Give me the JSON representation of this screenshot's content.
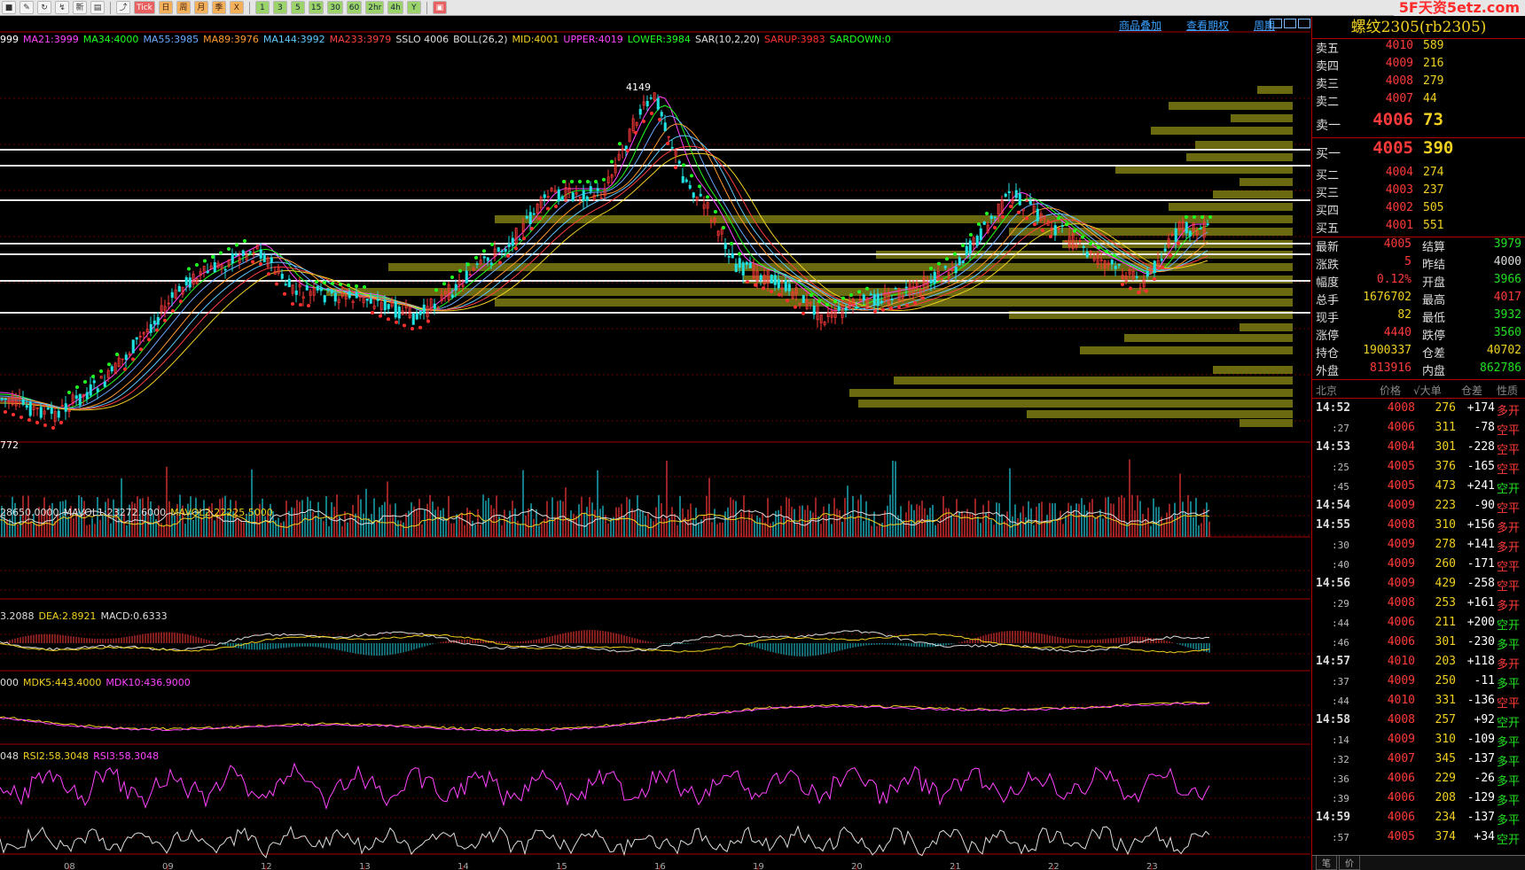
{
  "toolbar": {
    "buttons": [
      "■",
      "✎",
      "↻",
      "↯",
      "新",
      "▤",
      "⤴",
      "Tick",
      "日",
      "周",
      "月",
      "季",
      "X",
      "1",
      "3",
      "5",
      "15",
      "30",
      "60",
      "2hr",
      "4h",
      "Y",
      "▣"
    ],
    "watermark": "5F天资5etz.com"
  },
  "chart": {
    "links": [
      "商品叠加",
      "查看期权",
      "周期"
    ],
    "ma_legend": [
      {
        "text": "999",
        "color": "#ffffff"
      },
      {
        "text": "MA21:3999",
        "color": "#ff44ff"
      },
      {
        "text": "MA34:4000",
        "color": "#20ff20"
      },
      {
        "text": "MA55:3985",
        "color": "#6aa8ff"
      },
      {
        "text": "MA89:3976",
        "color": "#ff9a30"
      },
      {
        "text": "MA144:3992",
        "color": "#60c8ff"
      },
      {
        "text": "MA233:3979",
        "color": "#ff4040"
      },
      {
        "text": "SSLO 4006",
        "color": "#dddddd"
      },
      {
        "text": "BOLL(26,2)",
        "color": "#dddddd"
      },
      {
        "text": "MID:4001",
        "color": "#f0d020"
      },
      {
        "text": "UPPER:4019",
        "color": "#ff44ff"
      },
      {
        "text": "LOWER:3984",
        "color": "#20ff20"
      },
      {
        "text": "SAR(10,2,20)",
        "color": "#dddddd"
      },
      {
        "text": "SARUP:3983",
        "color": "#ff3030"
      },
      {
        "text": "SARDOWN:0",
        "color": "#20ff20"
      }
    ],
    "high_label": "4149",
    "low_label": "772",
    "vol_legend": [
      {
        "text": "28650.0000",
        "color": "#dddddd"
      },
      {
        "text": "MAVOL1:23272.6000",
        "color": "#dddddd"
      },
      {
        "text": "MAVOL2:22225.5000",
        "color": "#f0d020"
      }
    ],
    "macd_legend": [
      {
        "text": "3.2088",
        "color": "#dddddd"
      },
      {
        "text": "DEA:2.8921",
        "color": "#f0d020"
      },
      {
        "text": "MACD:0.6333",
        "color": "#dddddd"
      }
    ],
    "mdk_legend": [
      {
        "text": "000",
        "color": "#dddddd"
      },
      {
        "text": "MDK5:443.4000",
        "color": "#f0d020"
      },
      {
        "text": "MDK10:436.9000",
        "color": "#ff44ff"
      }
    ],
    "rsi_legend": [
      {
        "text": "048",
        "color": "#dddddd"
      },
      {
        "text": "RSI2:58.3048",
        "color": "#f0d020"
      },
      {
        "text": "RSI3:58.3048",
        "color": "#ff44ff"
      }
    ],
    "date_ticks": [
      "08",
      "09",
      "12",
      "13",
      "14",
      "15",
      "16",
      "19",
      "20",
      "21",
      "22",
      "23"
    ]
  },
  "quote": {
    "title": "螺纹2305(rb2305)",
    "asks": [
      {
        "label": "卖五",
        "price": "4010",
        "vol": "589"
      },
      {
        "label": "卖四",
        "price": "4009",
        "vol": "216"
      },
      {
        "label": "卖三",
        "price": "4008",
        "vol": "279"
      },
      {
        "label": "卖二",
        "price": "4007",
        "vol": "44"
      },
      {
        "label": "卖一",
        "price": "4006",
        "vol": "73"
      }
    ],
    "bids": [
      {
        "label": "买一",
        "price": "4005",
        "vol": "390"
      },
      {
        "label": "买二",
        "price": "4004",
        "vol": "274"
      },
      {
        "label": "买三",
        "price": "4003",
        "vol": "237"
      },
      {
        "label": "买四",
        "price": "4002",
        "vol": "505"
      },
      {
        "label": "买五",
        "price": "4001",
        "vol": "551"
      }
    ],
    "stats": [
      {
        "l1": "最新",
        "v1": "4005",
        "c1": "red",
        "l2": "结算",
        "v2": "3979",
        "c2": "green"
      },
      {
        "l1": "涨跌",
        "v1": "5",
        "c1": "red",
        "l2": "昨结",
        "v2": "4000",
        "c2": "white"
      },
      {
        "l1": "幅度",
        "v1": "0.12%",
        "c1": "red",
        "l2": "开盘",
        "v2": "3966",
        "c2": "green"
      },
      {
        "l1": "总手",
        "v1": "1676702",
        "c1": "yellow",
        "l2": "最高",
        "v2": "4017",
        "c2": "red"
      },
      {
        "l1": "现手",
        "v1": "82",
        "c1": "yellow",
        "l2": "最低",
        "v2": "3932",
        "c2": "green"
      },
      {
        "l1": "涨停",
        "v1": "4440",
        "c1": "red",
        "l2": "跌停",
        "v2": "3560",
        "c2": "green"
      },
      {
        "l1": "持仓",
        "v1": "1900337",
        "c1": "yellow",
        "l2": "仓差",
        "v2": "40702",
        "c2": "yellow"
      },
      {
        "l1": "外盘",
        "v1": "813916",
        "c1": "red",
        "l2": "内盘",
        "v2": "862786",
        "c2": "green"
      }
    ],
    "tick_header": [
      "北京",
      "价格",
      "√大单",
      "仓差",
      "性质"
    ],
    "ticks": [
      {
        "time": "14:52",
        "sub": false,
        "price": "4008",
        "pc": "red",
        "vol": "276",
        "oi": "+174",
        "oc": "white",
        "nature": "多开",
        "nc": "red"
      },
      {
        "time": ":27",
        "sub": true,
        "price": "4006",
        "pc": "red",
        "vol": "311",
        "oi": "-78",
        "oc": "white",
        "nature": "空平",
        "nc": "red"
      },
      {
        "time": "14:53",
        "sub": false,
        "price": "4004",
        "pc": "red",
        "vol": "301",
        "oi": "-228",
        "oc": "white",
        "nature": "空平",
        "nc": "red"
      },
      {
        "time": ":25",
        "sub": true,
        "price": "4005",
        "pc": "red",
        "vol": "376",
        "oi": "-165",
        "oc": "white",
        "nature": "空平",
        "nc": "red"
      },
      {
        "time": ":45",
        "sub": true,
        "price": "4005",
        "pc": "red",
        "vol": "473",
        "oi": "+241",
        "oc": "white",
        "nature": "空开",
        "nc": "green"
      },
      {
        "time": "14:54",
        "sub": false,
        "price": "4009",
        "pc": "red",
        "vol": "223",
        "oi": "-90",
        "oc": "white",
        "nature": "空平",
        "nc": "red"
      },
      {
        "time": "14:55",
        "sub": false,
        "price": "4008",
        "pc": "red",
        "vol": "310",
        "oi": "+156",
        "oc": "white",
        "nature": "多开",
        "nc": "red"
      },
      {
        "time": ":30",
        "sub": true,
        "price": "4009",
        "pc": "red",
        "vol": "278",
        "oi": "+141",
        "oc": "white",
        "nature": "多开",
        "nc": "red"
      },
      {
        "time": ":40",
        "sub": true,
        "price": "4009",
        "pc": "red",
        "vol": "260",
        "oi": "-171",
        "oc": "white",
        "nature": "空平",
        "nc": "red"
      },
      {
        "time": "14:56",
        "sub": false,
        "price": "4009",
        "pc": "red",
        "vol": "429",
        "oi": "-258",
        "oc": "white",
        "nature": "空平",
        "nc": "red"
      },
      {
        "time": ":29",
        "sub": true,
        "price": "4008",
        "pc": "red",
        "vol": "253",
        "oi": "+161",
        "oc": "white",
        "nature": "多开",
        "nc": "red"
      },
      {
        "time": ":44",
        "sub": true,
        "price": "4006",
        "pc": "red",
        "vol": "211",
        "oi": "+200",
        "oc": "white",
        "nature": "空开",
        "nc": "green"
      },
      {
        "time": ":46",
        "sub": true,
        "price": "4006",
        "pc": "red",
        "vol": "301",
        "oi": "-230",
        "oc": "white",
        "nature": "多平",
        "nc": "green"
      },
      {
        "time": "14:57",
        "sub": false,
        "price": "4010",
        "pc": "red",
        "vol": "203",
        "oi": "+118",
        "oc": "white",
        "nature": "多开",
        "nc": "red"
      },
      {
        "time": ":37",
        "sub": true,
        "price": "4009",
        "pc": "red",
        "vol": "250",
        "oi": "-11",
        "oc": "white",
        "nature": "多平",
        "nc": "green"
      },
      {
        "time": ":44",
        "sub": true,
        "price": "4010",
        "pc": "red",
        "vol": "331",
        "oi": "-136",
        "oc": "white",
        "nature": "空平",
        "nc": "red"
      },
      {
        "time": "14:58",
        "sub": false,
        "price": "4008",
        "pc": "red",
        "vol": "257",
        "oi": "+92",
        "oc": "white",
        "nature": "空开",
        "nc": "green"
      },
      {
        "time": ":14",
        "sub": true,
        "price": "4009",
        "pc": "red",
        "vol": "310",
        "oi": "-109",
        "oc": "white",
        "nature": "多平",
        "nc": "green"
      },
      {
        "time": ":32",
        "sub": true,
        "price": "4007",
        "pc": "red",
        "vol": "345",
        "oi": "-137",
        "oc": "white",
        "nature": "多平",
        "nc": "green"
      },
      {
        "time": ":36",
        "sub": true,
        "price": "4006",
        "pc": "red",
        "vol": "229",
        "oi": "-26",
        "oc": "white",
        "nature": "多平",
        "nc": "green"
      },
      {
        "time": ":39",
        "sub": true,
        "price": "4006",
        "pc": "red",
        "vol": "208",
        "oi": "-129",
        "oc": "white",
        "nature": "多平",
        "nc": "green"
      },
      {
        "time": "14:59",
        "sub": false,
        "price": "4006",
        "pc": "red",
        "vol": "234",
        "oi": "-137",
        "oc": "white",
        "nature": "多平",
        "nc": "green"
      },
      {
        "time": ":57",
        "sub": true,
        "price": "4005",
        "pc": "red",
        "vol": "374",
        "oi": "+34",
        "oc": "white",
        "nature": "空开",
        "nc": "green"
      }
    ],
    "tabs": [
      "笔",
      "价"
    ]
  }
}
